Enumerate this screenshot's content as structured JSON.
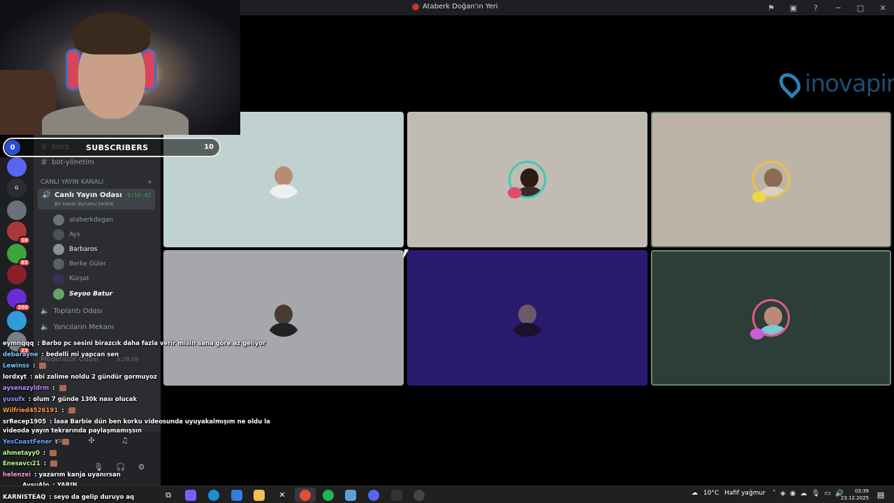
{
  "window": {
    "title": "Ataberk Doğan'ın Yeri"
  },
  "overlay": {
    "subscribers": {
      "current": "0",
      "label": "SUBSCRIBERS",
      "goal": "10"
    }
  },
  "servers": [
    {
      "badge": ""
    },
    {
      "badge": ""
    },
    {
      "badge": "10"
    },
    {
      "badge": "85"
    },
    {
      "badge": ""
    },
    {
      "badge": "200"
    },
    {
      "badge": ""
    },
    {
      "badge": "23"
    }
  ],
  "channels": {
    "text1": "blerp",
    "text2": "bot-yönetim",
    "category": "CANLI YAYIN KANALI",
    "voice_active": {
      "name": "Canlı Yayın Odası",
      "timer": "9:10:42",
      "status": "Bir kanal durumu belirle"
    },
    "members": [
      "ataberkdogan",
      "Ays",
      "Barbaros",
      "Berke Güler",
      "Kürşat",
      "Seyoo Batur"
    ],
    "voice2": "Toplantı Odası",
    "voice3": "Yancıların Mekanı",
    "voice4": "Moderatör Odası",
    "voice4_timer": "5:29:09"
  },
  "chat": [
    {
      "user": "eymnqqq",
      "color": "#ffffff",
      "text": "Barbo pc sesini birazcık daha fazla verir misin sana göre az geliyor"
    },
    {
      "user": "debarayne",
      "color": "#7ec8ff",
      "text": "bedelli mi yapcan sen"
    },
    {
      "user": "Lewinss",
      "color": "#7ec8ff",
      "text": ""
    },
    {
      "user": "lordxyt",
      "color": "#ffffff",
      "text": "abi zalime noldu 2 gündür gormuyoz"
    },
    {
      "user": "aysenazyldrm",
      "color": "#c58bff",
      "text": ""
    },
    {
      "user": "yusufx",
      "color": "#8f9bff",
      "text": "olum 7 günde 130k nası olucak"
    },
    {
      "user": "Wilfried4526191",
      "color": "#ff9c4b",
      "text": ""
    },
    {
      "user": "srRecep1905",
      "color": "#ffffff",
      "text": "laaa Barbie dün ben korku videosunda uyuyakalmışım ne oldu la"
    },
    {
      "user": "",
      "color": "#ffffff",
      "text": "videoda yayın tekrarında paylaşmamışsın"
    },
    {
      "user": "YesCoastFener",
      "color": "#6aa9ff",
      "text": ""
    },
    {
      "user": "ahmetayy0",
      "color": "#b7ff8a",
      "text": ""
    },
    {
      "user": "Enesavcı21",
      "color": "#b7ff8a",
      "text": ""
    },
    {
      "user": "helenzei",
      "color": "#ff9cd6",
      "text": "yazarım kanja uyanırsan"
    },
    {
      "user": "AysuAlp",
      "color": "#ffffff",
      "text": "YARIN"
    },
    {
      "user": "KARNISTEAQ",
      "color": "#ffffff",
      "text": "seyo da gelip duruyo aq"
    }
  ],
  "brand": {
    "name": "inovapin"
  },
  "taskbar": {
    "weather_temp": "10°C",
    "weather_desc": "Hafif yağmur",
    "time": "03:39",
    "date": "23.12.2025"
  }
}
